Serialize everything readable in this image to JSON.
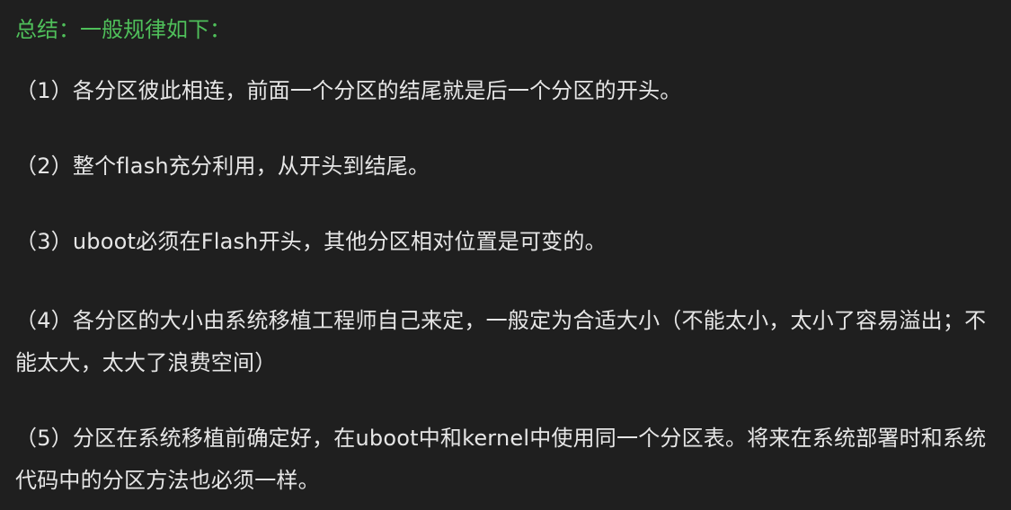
{
  "heading": "总结：一般规律如下：",
  "paragraphs": [
    "（1）各分区彼此相连，前面一个分区的结尾就是后一个分区的开头。",
    "（2）整个flash充分利用，从开头到结尾。",
    "（3）uboot必须在Flash开头，其他分区相对位置是可变的。",
    "（4）各分区的大小由系统移植工程师自己来定，一般定为合适大小（不能太小，太小了容易溢出；不能太大，太大了浪费空间）",
    "（5）分区在系统移植前确定好，在uboot中和kernel中使用同一个分区表。将来在系统部署时和系统代码中的分区方法也必须一样。"
  ],
  "colors": {
    "background": "#1f1f1f",
    "heading": "#4fbf5a",
    "text": "#e6e6e6"
  }
}
